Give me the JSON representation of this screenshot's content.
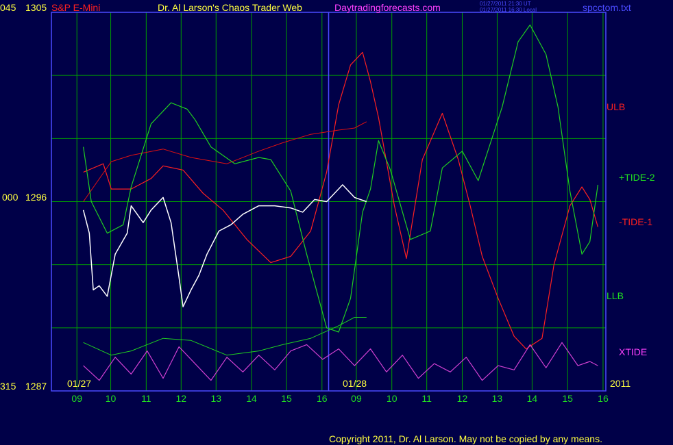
{
  "header": {
    "y_top_labels": [
      "045",
      "1305"
    ],
    "instrument": "S&P E-Mini",
    "title": "Dr. Al Larson's Chaos Trader Web",
    "site": "Daytradingforecasts.com",
    "stamp_ut": "01/27/2011 21:30 UT",
    "stamp_local": "01/27/2011 16:30 Local",
    "filename": "spcctom.txt"
  },
  "footer": {
    "copyright": "Copyright 2011, Dr. Al Larson. May not be copied by any means."
  },
  "colors": {
    "background": "#000048",
    "grid": "#00a000",
    "axis": "#4a4aff",
    "price": "#ffffff",
    "ulb_llb": "#e01010",
    "tide1": "#ff2020",
    "tide2": "#20d020",
    "xtide": "#d040d0",
    "ma_yellow": "#ffff40",
    "ma_blue": "#3040ff"
  },
  "chart_data": {
    "type": "line",
    "title": "S&P E-Mini",
    "y_axis": {
      "ylim": [
        1287,
        1305
      ],
      "tick_labels": [
        {
          "osc": "045",
          "price": "1305"
        },
        {
          "osc": "000",
          "price": "1296"
        },
        {
          "osc": "315",
          "price": "1287"
        }
      ]
    },
    "x_axis": {
      "date_labels": [
        "01/27",
        "01/28",
        "2011"
      ],
      "hour_labels": [
        "09",
        "10",
        "11",
        "12",
        "13",
        "14",
        "15",
        "16",
        "09",
        "10",
        "11",
        "12",
        "13",
        "14",
        "15",
        "16"
      ]
    },
    "legend": [
      "ULB",
      "+TIDE-2",
      "-TIDE-1",
      "LLB",
      "XTIDE"
    ],
    "grid": true,
    "series": [
      {
        "name": "ULB",
        "x": [
          8.8,
          9.5,
          10.0,
          10.8,
          11.5,
          12.4,
          13.2,
          13.8,
          14.5,
          15.2,
          15.6,
          15.9
        ],
        "values": [
          1296.0,
          1297.9,
          1298.2,
          1298.5,
          1298.1,
          1297.8,
          1298.4,
          1298.8,
          1299.2,
          1299.4,
          1299.5,
          1299.8
        ]
      },
      {
        "name": "LLB",
        "x": [
          8.8,
          9.5,
          10.0,
          10.8,
          11.5,
          12.4,
          13.2,
          13.8,
          14.5,
          15.2,
          15.6,
          15.9
        ],
        "values": [
          1289.3,
          1288.7,
          1288.9,
          1289.5,
          1289.4,
          1288.7,
          1288.9,
          1289.2,
          1289.5,
          1290.1,
          1290.5,
          1290.5
        ]
      },
      {
        "name": "-TIDE-1",
        "x": [
          8.8,
          9.3,
          9.5,
          10.0,
          10.5,
          10.8,
          11.3,
          11.8,
          12.3,
          12.9,
          13.5,
          14.0,
          14.5,
          14.9,
          15.2,
          15.5,
          15.8,
          16.0,
          16.2,
          16.6,
          16.9,
          17.3,
          17.8,
          18.2,
          18.5,
          18.8,
          19.2,
          19.6,
          19.9,
          20.3,
          20.6,
          21.0,
          21.3,
          21.5,
          21.7
        ],
        "values": [
          1297.4,
          1297.8,
          1296.6,
          1296.6,
          1297.1,
          1297.7,
          1297.5,
          1296.4,
          1295.6,
          1294.2,
          1293.1,
          1293.4,
          1294.6,
          1297.4,
          1300.6,
          1302.5,
          1303.1,
          1301.7,
          1300.0,
          1295.8,
          1293.3,
          1298.0,
          1300.2,
          1298.0,
          1295.8,
          1293.4,
          1291.4,
          1289.6,
          1289.0,
          1289.5,
          1293.0,
          1295.8,
          1296.7,
          1296.1,
          1294.8
        ],
        "note_values_are_oscillator_plotted_on_price_scale": null
      },
      {
        "name": "+TIDE-2",
        "x": [
          8.8,
          9.0,
          9.4,
          9.8,
          10.0,
          10.5,
          11.0,
          11.4,
          11.6,
          12.0,
          12.6,
          13.2,
          13.5,
          14.0,
          14.4,
          14.9,
          15.2,
          15.5,
          15.8,
          16.0,
          16.2,
          16.5,
          17.0,
          17.5,
          17.8,
          18.3,
          18.7,
          19.3,
          19.7,
          20.0,
          20.4,
          20.7,
          21.0,
          21.3,
          21.5,
          21.7
        ],
        "values": [
          1298.6,
          1296.0,
          1294.5,
          1294.9,
          1296.7,
          1299.7,
          1300.7,
          1300.4,
          1299.9,
          1298.6,
          1297.8,
          1298.1,
          1298.0,
          1296.5,
          1293.5,
          1290.0,
          1289.8,
          1291.4,
          1295.5,
          1296.6,
          1298.9,
          1297.5,
          1294.2,
          1294.6,
          1297.6,
          1298.4,
          1297.0,
          1300.5,
          1303.6,
          1304.4,
          1303.0,
          1300.5,
          1296.5,
          1293.5,
          1294.1,
          1296.8
        ]
      },
      {
        "name": "XTIDE",
        "x": [
          8.8,
          9.2,
          9.6,
          10.0,
          10.4,
          10.8,
          11.2,
          11.6,
          12.0,
          12.4,
          12.8,
          13.2,
          13.6,
          14.0,
          14.4,
          14.8,
          15.2,
          15.6,
          16.0,
          16.4,
          16.8,
          17.2,
          17.6,
          18.0,
          18.4,
          18.8,
          19.2,
          19.6,
          20.0,
          20.4,
          20.8,
          21.2,
          21.5,
          21.7
        ],
        "values": [
          1288.2,
          1287.5,
          1288.6,
          1287.8,
          1288.9,
          1287.6,
          1289.1,
          1288.3,
          1287.5,
          1288.6,
          1287.9,
          1288.7,
          1288.0,
          1288.9,
          1289.2,
          1288.5,
          1289.0,
          1288.2,
          1289.0,
          1287.9,
          1288.7,
          1287.6,
          1288.3,
          1287.9,
          1288.6,
          1287.5,
          1288.2,
          1288.0,
          1289.2,
          1288.1,
          1289.3,
          1288.2,
          1288.4,
          1288.2
        ]
      },
      {
        "name": "price",
        "x": [
          8.8,
          8.95,
          9.05,
          9.2,
          9.4,
          9.6,
          9.9,
          10.0,
          10.3,
          10.5,
          10.8,
          11.0,
          11.2,
          11.3,
          11.5,
          11.7,
          11.9,
          12.2,
          12.5,
          12.8,
          13.2,
          13.6,
          14.0,
          14.3,
          14.6,
          14.9,
          15.3,
          15.6,
          15.9
        ],
        "values": [
          1295.6,
          1294.5,
          1291.8,
          1292.0,
          1291.5,
          1293.5,
          1294.5,
          1295.8,
          1295.0,
          1295.6,
          1296.2,
          1295.0,
          1292.4,
          1291.0,
          1291.8,
          1292.5,
          1293.5,
          1294.6,
          1294.9,
          1295.4,
          1295.8,
          1295.8,
          1295.7,
          1295.5,
          1296.1,
          1296.0,
          1296.8,
          1296.2,
          1296.0
        ]
      }
    ]
  }
}
